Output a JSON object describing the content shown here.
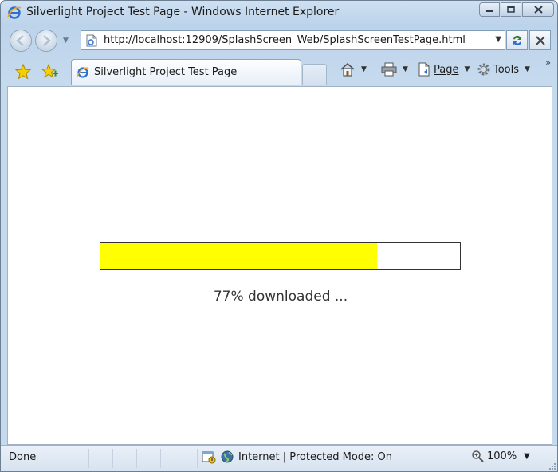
{
  "window": {
    "title": "Silverlight Project Test Page - Windows Internet Explorer"
  },
  "address": {
    "url": "http://localhost:12909/SplashScreen_Web/SplashScreenTestPage.html"
  },
  "tab": {
    "label": "Silverlight Project Test Page"
  },
  "commands": {
    "page_label": "Page",
    "tools_label": "Tools"
  },
  "content": {
    "progress_text": "77% downloaded ...",
    "progress_percent": 77,
    "progress_fill_color": "#ffff00"
  },
  "status": {
    "text": "Done",
    "zone_text": "Internet | Protected Mode: On",
    "zoom_text": "100%"
  },
  "icons": {
    "title": "ie-logo-icon",
    "back": "back-arrow-icon",
    "forward": "forward-arrow-icon",
    "refresh": "refresh-icon",
    "stop": "stop-x-icon",
    "favorites": "favorites-star-icon",
    "add_favorites": "add-favorites-icon",
    "home": "home-icon",
    "print": "print-icon",
    "page": "page-icon",
    "tools": "gear-icon",
    "zone": "globe-icon",
    "zoom": "magnifier-icon"
  }
}
